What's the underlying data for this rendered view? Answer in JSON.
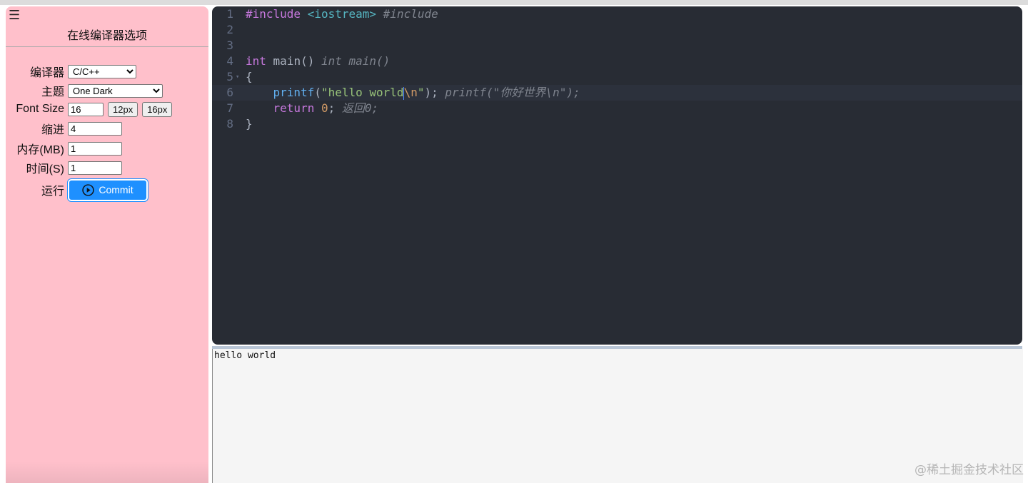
{
  "sidebar": {
    "menu_icon": "☰",
    "title": "在线编译器选项",
    "compiler_label": "编译器",
    "compiler_value": "C/C++",
    "theme_label": "主题",
    "theme_value": "One Dark",
    "font_size_label": "Font Size",
    "font_size_value": "16",
    "btn_12px": "12px",
    "btn_16px": "16px",
    "indent_label": "缩进",
    "indent_value": "4",
    "memory_label": "内存(MB)",
    "memory_value": "1",
    "time_label": "时间(S)",
    "time_value": "1",
    "run_label": "运行",
    "commit_label": "Commit"
  },
  "editor": {
    "line_numbers": [
      "1",
      "2",
      "3",
      "4",
      "5",
      "6",
      "7",
      "8"
    ],
    "line1": {
      "directive": "#include",
      "header": "<iostream>",
      "comment": "#include"
    },
    "line4": {
      "type": "int",
      "rest": " main()",
      "comment": "int main()"
    },
    "line5": {
      "brace": "{"
    },
    "line6": {
      "func": "printf",
      "open": "(",
      "str1": "\"hello world",
      "esc": "\\n",
      "str2": "\"",
      "close": ");",
      "comment": "printf(\"你好世界\\n\");"
    },
    "line7": {
      "kw": "return",
      "num": "0",
      "semi": ";",
      "comment": "返回0;"
    },
    "line8": {
      "brace": "}"
    }
  },
  "output": {
    "text": "hello world"
  },
  "watermark": "@稀土掘金技术社区"
}
